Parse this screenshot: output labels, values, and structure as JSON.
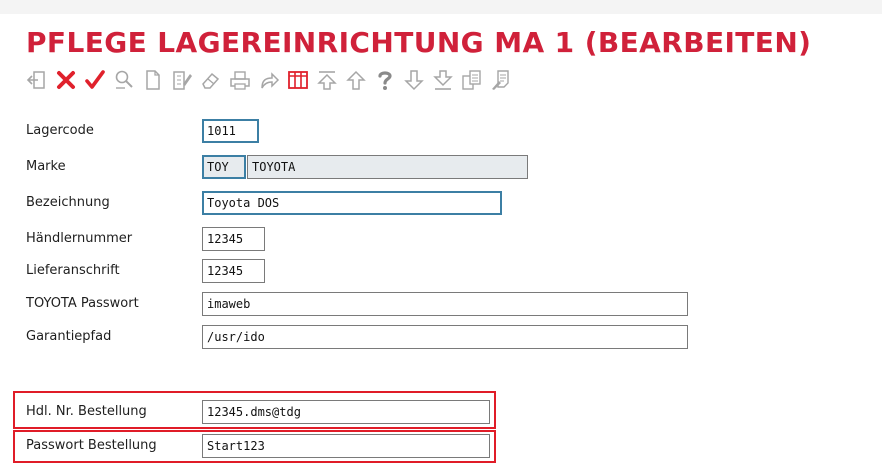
{
  "page": {
    "title": "PFLEGE LAGEREINRICHTUNG MA 1 (BEARBEITEN)"
  },
  "toolbar": [
    {
      "name": "exit-icon"
    },
    {
      "name": "cancel-icon"
    },
    {
      "name": "confirm-icon"
    },
    {
      "name": "search-icon"
    },
    {
      "name": "new-document-icon"
    },
    {
      "name": "edit-document-icon"
    },
    {
      "name": "eraser-icon"
    },
    {
      "name": "print-icon"
    },
    {
      "name": "forward-icon"
    },
    {
      "name": "table-columns-icon"
    },
    {
      "name": "first-record-icon"
    },
    {
      "name": "previous-record-icon"
    },
    {
      "name": "help-icon"
    },
    {
      "name": "next-record-icon"
    },
    {
      "name": "last-record-icon"
    },
    {
      "name": "copy-record-icon"
    },
    {
      "name": "notes-icon"
    }
  ],
  "form": {
    "lagercode": {
      "label": "Lagercode",
      "value": "1011"
    },
    "marke": {
      "label": "Marke",
      "code": "TOY",
      "name": "TOYOTA"
    },
    "bezeichnung": {
      "label": "Bezeichnung",
      "value": "Toyota DOS"
    },
    "haendlernummer": {
      "label": "Händlernummer",
      "value": "12345"
    },
    "lieferanschrift": {
      "label": "Lieferanschrift",
      "value": "12345"
    },
    "passwort": {
      "label": "TOYOTA Passwort",
      "value": "imaweb"
    },
    "garantiepfad": {
      "label": "Garantiepfad",
      "value": "/usr/ido"
    },
    "hdl_bestellung": {
      "label": "Hdl. Nr. Bestellung",
      "value": "12345.dms@tdg"
    },
    "passwort_bestellung": {
      "label": "Passwort Bestellung",
      "value": "Start123"
    }
  },
  "colors": {
    "title": "#d0213a",
    "focus_border": "#3c7fa4",
    "highlight": "#e01c28",
    "icon_gray": "#a6a6a6",
    "icon_red": "#e0212c"
  }
}
